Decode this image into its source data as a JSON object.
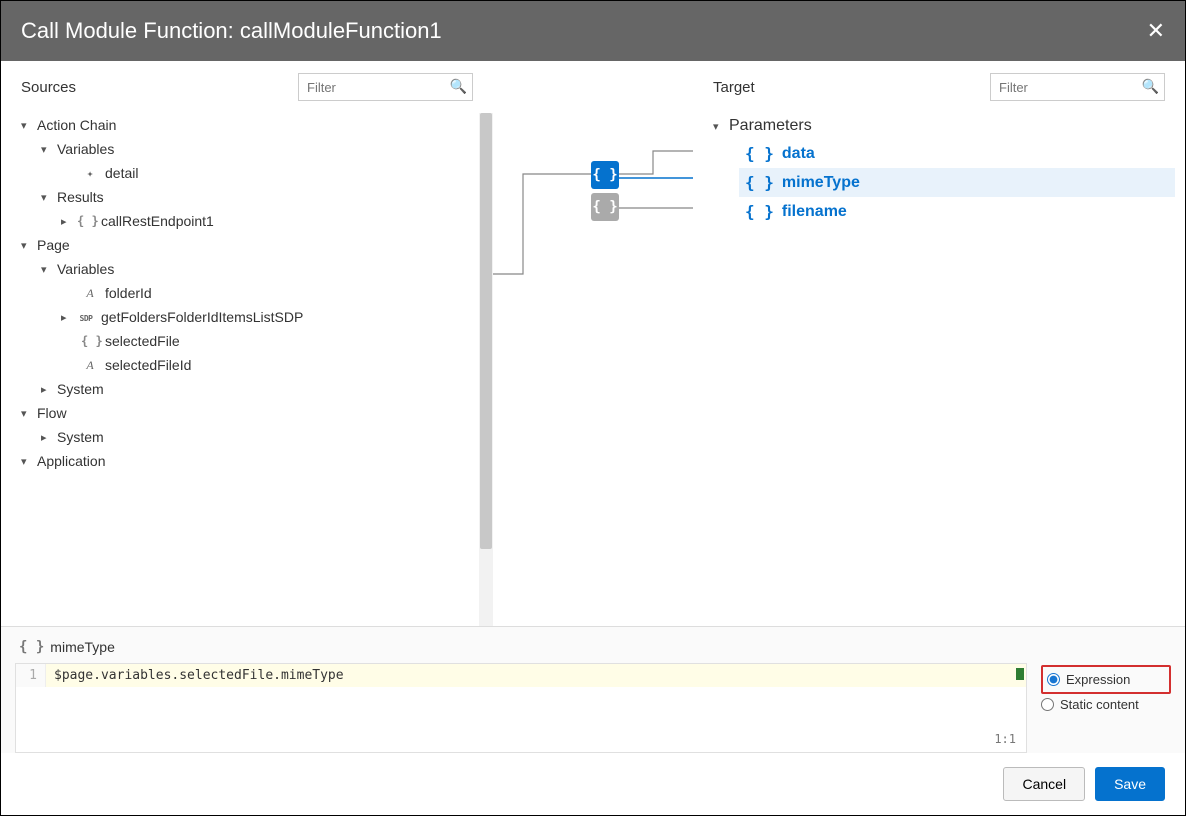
{
  "dialog": {
    "title": "Call Module Function: callModuleFunction1"
  },
  "sources": {
    "heading": "Sources",
    "filter_placeholder": "Filter",
    "tree": {
      "actionChain": {
        "label": "Action Chain"
      },
      "variables": {
        "label": "Variables"
      },
      "detail": {
        "label": "detail"
      },
      "results": {
        "label": "Results"
      },
      "callRest": {
        "label": "callRestEndpoint1"
      },
      "page": {
        "label": "Page"
      },
      "pageVars": {
        "label": "Variables"
      },
      "folderId": {
        "label": "folderId"
      },
      "sdp": {
        "label": "getFoldersFolderIdItemsListSDP"
      },
      "selectedFile": {
        "label": "selectedFile"
      },
      "selectedFileId": {
        "label": "selectedFileId"
      },
      "systemPage": {
        "label": "System"
      },
      "flow": {
        "label": "Flow"
      },
      "systemFlow": {
        "label": "System"
      },
      "application": {
        "label": "Application"
      }
    }
  },
  "target": {
    "heading": "Target",
    "filter_placeholder": "Filter",
    "parametersLabel": "Parameters",
    "params": {
      "data": "data",
      "mimeType": "mimeType",
      "filename": "filename"
    }
  },
  "editor": {
    "selected_label": "mimeType",
    "line_number": "1",
    "code": "$page.variables.selectedFile.mimeType",
    "cursor": "1:1",
    "radio_expression": "Expression",
    "radio_static": "Static content"
  },
  "footer": {
    "cancel": "Cancel",
    "save": "Save"
  }
}
